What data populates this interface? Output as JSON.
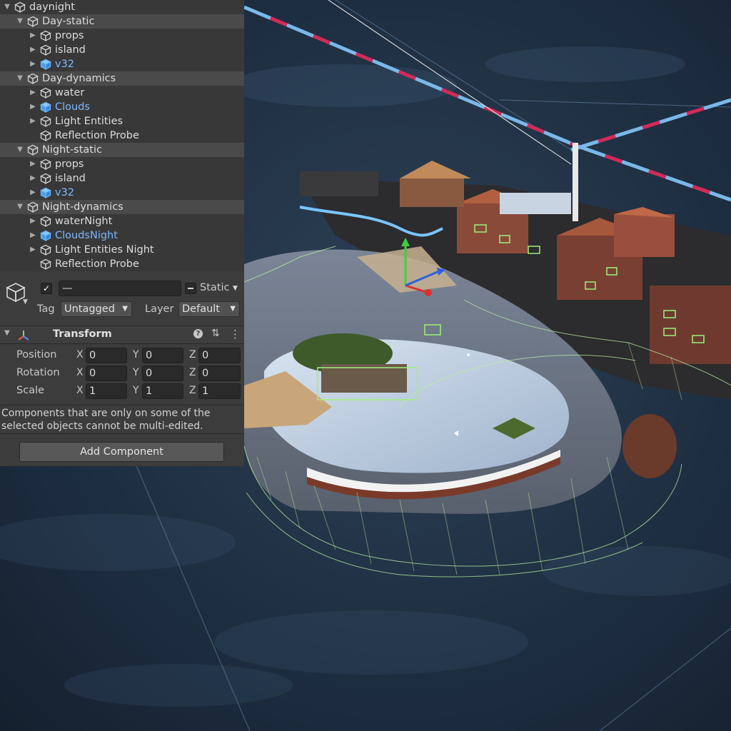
{
  "hierarchy": {
    "items": [
      {
        "label": "daynight",
        "level": 0,
        "group": false,
        "expanded": true,
        "prefab": false
      },
      {
        "label": "Day-static",
        "level": 1,
        "group": true,
        "expanded": true,
        "prefab": false
      },
      {
        "label": "props",
        "level": 2,
        "group": false,
        "expanded": false,
        "prefab": false
      },
      {
        "label": "island",
        "level": 2,
        "group": false,
        "expanded": false,
        "prefab": false
      },
      {
        "label": "v32",
        "level": 2,
        "group": false,
        "expanded": false,
        "prefab": true
      },
      {
        "label": "Day-dynamics",
        "level": 1,
        "group": true,
        "expanded": true,
        "prefab": false
      },
      {
        "label": "water",
        "level": 2,
        "group": false,
        "expanded": false,
        "prefab": false
      },
      {
        "label": "Clouds",
        "level": 2,
        "group": false,
        "expanded": false,
        "prefab": true
      },
      {
        "label": "Light Entities",
        "level": 2,
        "group": false,
        "expanded": false,
        "prefab": false
      },
      {
        "label": "Reflection Probe",
        "level": 2,
        "group": false,
        "expanded": null,
        "prefab": false
      },
      {
        "label": "Night-static",
        "level": 1,
        "group": true,
        "expanded": true,
        "prefab": false
      },
      {
        "label": "props",
        "level": 2,
        "group": false,
        "expanded": false,
        "prefab": false
      },
      {
        "label": "island",
        "level": 2,
        "group": false,
        "expanded": false,
        "prefab": false
      },
      {
        "label": "v32",
        "level": 2,
        "group": false,
        "expanded": false,
        "prefab": true
      },
      {
        "label": "Night-dynamics",
        "level": 1,
        "group": true,
        "expanded": true,
        "prefab": false
      },
      {
        "label": "waterNight",
        "level": 2,
        "group": false,
        "expanded": false,
        "prefab": false
      },
      {
        "label": "CloudsNight",
        "level": 2,
        "group": false,
        "expanded": false,
        "prefab": true
      },
      {
        "label": "Light Entities Night",
        "level": 2,
        "group": false,
        "expanded": false,
        "prefab": false
      },
      {
        "label": "Reflection Probe",
        "level": 2,
        "group": false,
        "expanded": null,
        "prefab": false
      }
    ]
  },
  "inspector": {
    "active_checked": true,
    "name_value": "—",
    "static_label": "Static",
    "tag_label": "Tag",
    "tag_value": "Untagged",
    "layer_label": "Layer",
    "layer_value": "Default",
    "component_title": "Transform",
    "position_label": "Position",
    "rotation_label": "Rotation",
    "scale_label": "Scale",
    "axis_x": "X",
    "axis_y": "Y",
    "axis_z": "Z",
    "position": {
      "x": "0",
      "y": "0",
      "z": "0"
    },
    "rotation": {
      "x": "0",
      "y": "0",
      "z": "0"
    },
    "scale": {
      "x": "1",
      "y": "1",
      "z": "1"
    },
    "multi_edit_note": "Components that are only on some of the selected objects cannot be multi-edited.",
    "add_component_label": "Add Component"
  },
  "icons": {
    "fold_expanded": "▼",
    "fold_collapsed": "▶",
    "caret": "▼",
    "check": "✓",
    "help": "?",
    "settings": "⇅",
    "more": "⋮"
  },
  "colors": {
    "panel_bg": "#383838",
    "group_row_bg": "#4a4a4a",
    "prefab_text": "#7cb8ff",
    "prefab_icon": "#6ab4f5",
    "water": "#1b2a3b"
  }
}
